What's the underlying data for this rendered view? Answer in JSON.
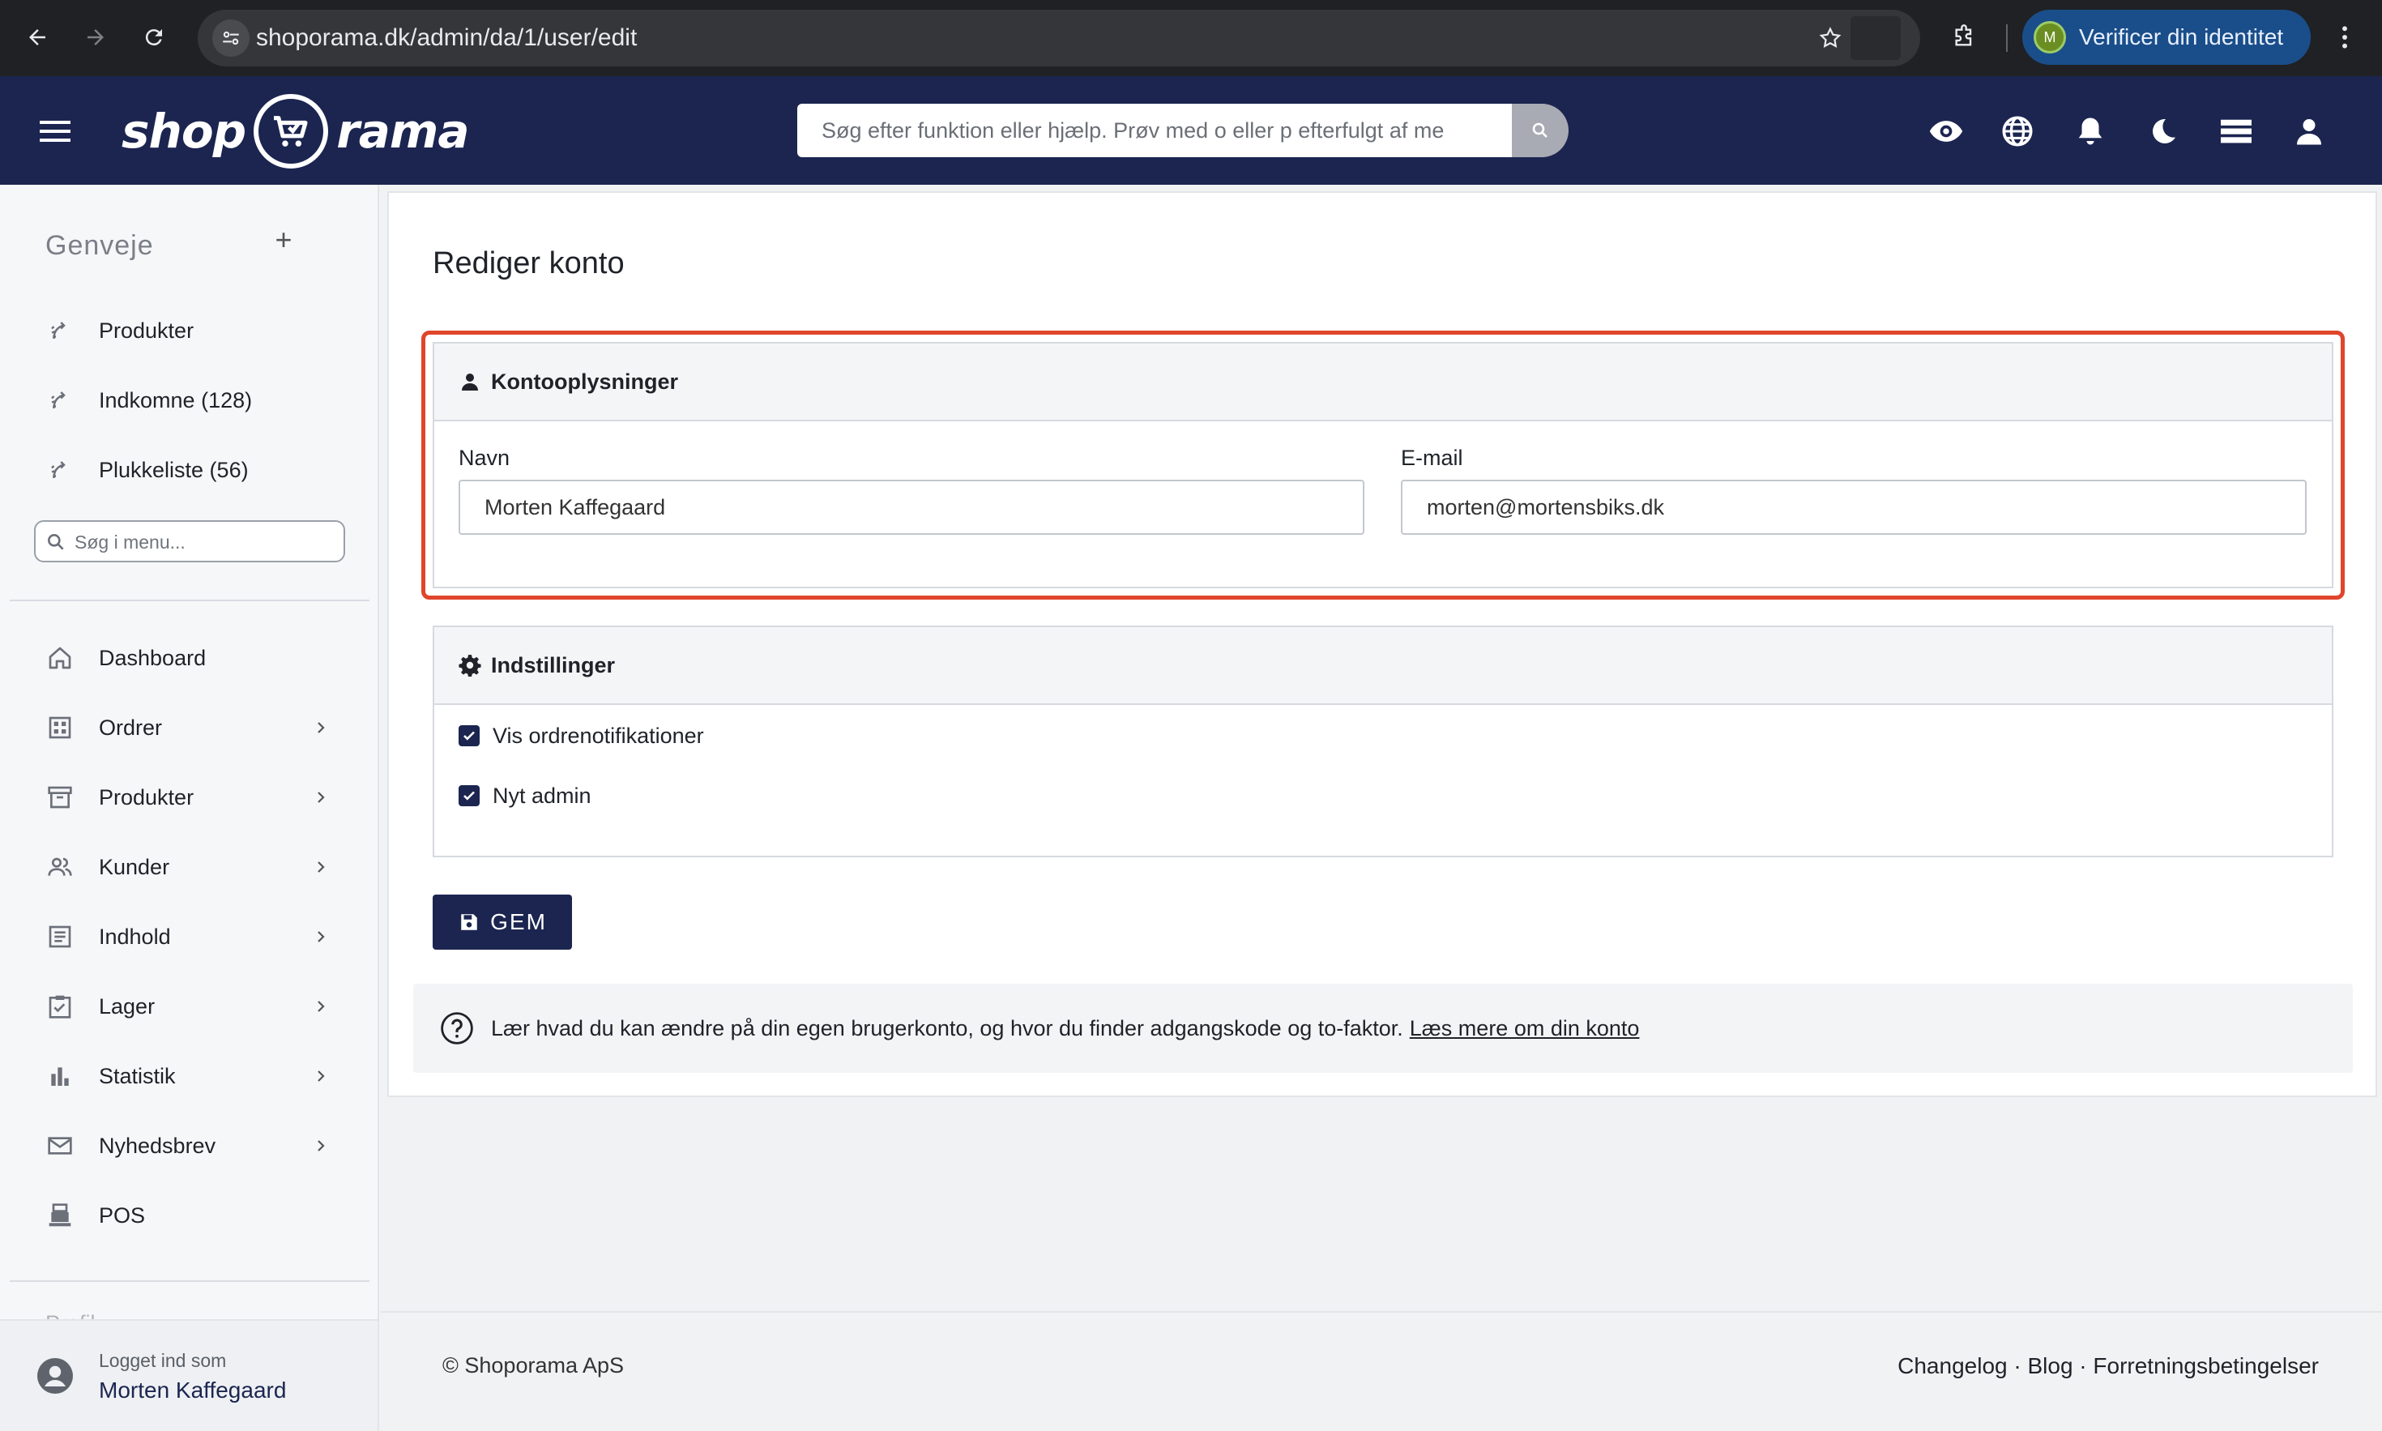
{
  "browser": {
    "url": "shoporama.dk/admin/da/1/user/edit",
    "verify_label": "Verificer din identitet",
    "profile_initial": "M"
  },
  "header": {
    "logo_left": "shop",
    "logo_right": "rama",
    "search_placeholder": "Søg efter funktion eller hjælp. Prøv med o eller p efterfulgt af me",
    "icons": [
      "eye-icon",
      "globe-icon",
      "bell-icon",
      "moon-icon",
      "list-icon",
      "person-icon"
    ]
  },
  "sidebar": {
    "shortcuts_title": "Genveje",
    "add_symbol": "+",
    "shortcuts": [
      {
        "label": "Produkter"
      },
      {
        "label": "Indkomne (128)"
      },
      {
        "label": "Plukkeliste (56)"
      }
    ],
    "menu_search_placeholder": "Søg i menu...",
    "nav": [
      {
        "label": "Dashboard",
        "icon": "home-icon",
        "has_children": false
      },
      {
        "label": "Ordrer",
        "icon": "grid-icon",
        "has_children": true
      },
      {
        "label": "Produkter",
        "icon": "archive-icon",
        "has_children": true
      },
      {
        "label": "Kunder",
        "icon": "people-icon",
        "has_children": true
      },
      {
        "label": "Indhold",
        "icon": "document-icon",
        "has_children": true
      },
      {
        "label": "Lager",
        "icon": "clipboard-check-icon",
        "has_children": true
      },
      {
        "label": "Statistik",
        "icon": "bar-chart-icon",
        "has_children": true
      },
      {
        "label": "Nyhedsbrev",
        "icon": "mail-icon",
        "has_children": true
      },
      {
        "label": "POS",
        "icon": "register-icon",
        "has_children": false
      }
    ],
    "faded_label": "Profil",
    "logged_in_label": "Logget ind som",
    "logged_in_name": "Morten Kaffegaard"
  },
  "main": {
    "title": "Rediger konto",
    "account_panel": {
      "heading": "Kontooplysninger",
      "name_label": "Navn",
      "name_value": "Morten Kaffegaard",
      "email_label": "E-mail",
      "email_value": "morten@mortensbiks.dk"
    },
    "settings_panel": {
      "heading": "Indstillinger",
      "options": [
        {
          "label": "Vis ordrenotifikationer",
          "checked": true
        },
        {
          "label": "Nyt admin",
          "checked": true
        }
      ]
    },
    "save_label": "GEM",
    "info_text": "Lær hvad du kan ændre på din egen brugerkonto, og hvor du finder adgangskode og to-faktor.",
    "info_link": "Læs mere om din konto"
  },
  "footer": {
    "copyright": "© Shoporama ApS",
    "links": "Changelog · Blog · Forretningsbetingelser"
  },
  "colors": {
    "brand_navy": "#1b2550",
    "highlight_red": "#e0452b"
  }
}
